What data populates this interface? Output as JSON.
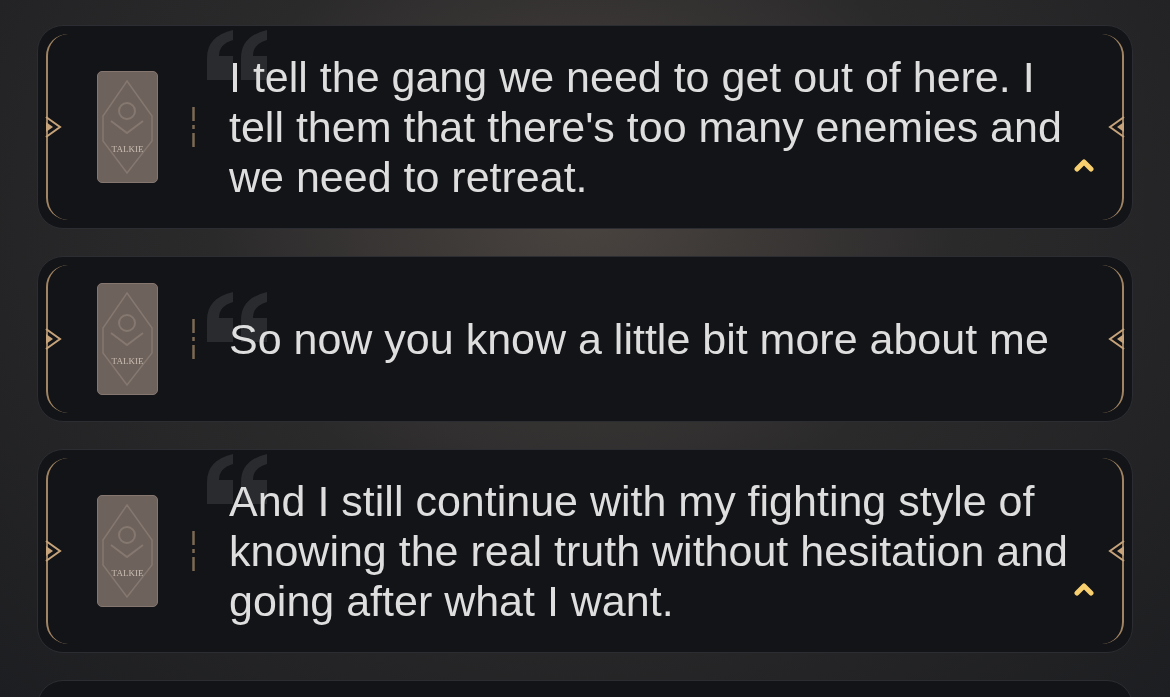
{
  "messages": [
    {
      "text": "I tell the gang we need to get out of here. I tell them that there's too many enemies and we need to retreat.",
      "card_logo": "TALKIE",
      "collapsible": true
    },
    {
      "text": "So now you know a little bit more about me",
      "card_logo": "TALKIE",
      "collapsible": false
    },
    {
      "text": "And I still continue with my fighting style of knowing the real truth without hesitation and going after what I want.",
      "card_logo": "TALKIE",
      "collapsible": true
    }
  ]
}
